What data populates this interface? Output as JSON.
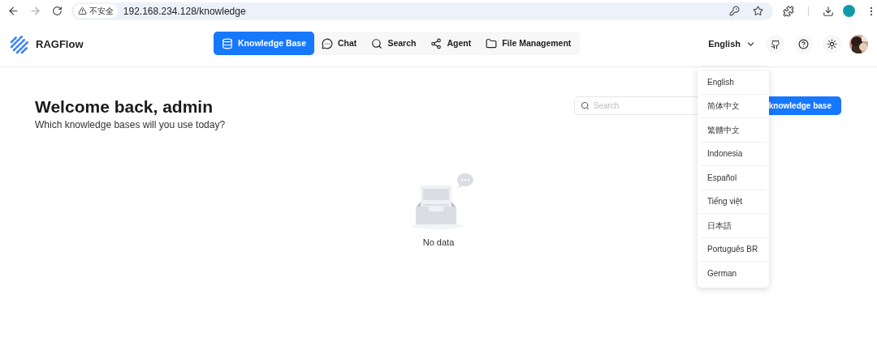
{
  "browser": {
    "security_label": "不安全",
    "url": "192.168.234.128/knowledge"
  },
  "app": {
    "name": "RAGFlow"
  },
  "nav": [
    {
      "label": "Knowledge Base",
      "selected": true,
      "kind": "database"
    },
    {
      "label": "Chat",
      "selected": false,
      "kind": "chat"
    },
    {
      "label": "Search",
      "selected": false,
      "kind": "search"
    },
    {
      "label": "Agent",
      "selected": false,
      "kind": "agent"
    },
    {
      "label": "File Management",
      "selected": false,
      "kind": "folder"
    }
  ],
  "language": {
    "current": "English",
    "expanded": true,
    "options": [
      "English",
      "简体中文",
      "繁體中文",
      "Indonesia",
      "Español",
      "Tiếng việt",
      "日本語",
      "Português BR",
      "German"
    ]
  },
  "page": {
    "title": "Welcome back, admin",
    "subtitle": "Which knowledge bases will you use today?",
    "search": {
      "placeholder": "Search"
    },
    "create_button": "knowledge base"
  },
  "empty": {
    "message": "No data"
  }
}
